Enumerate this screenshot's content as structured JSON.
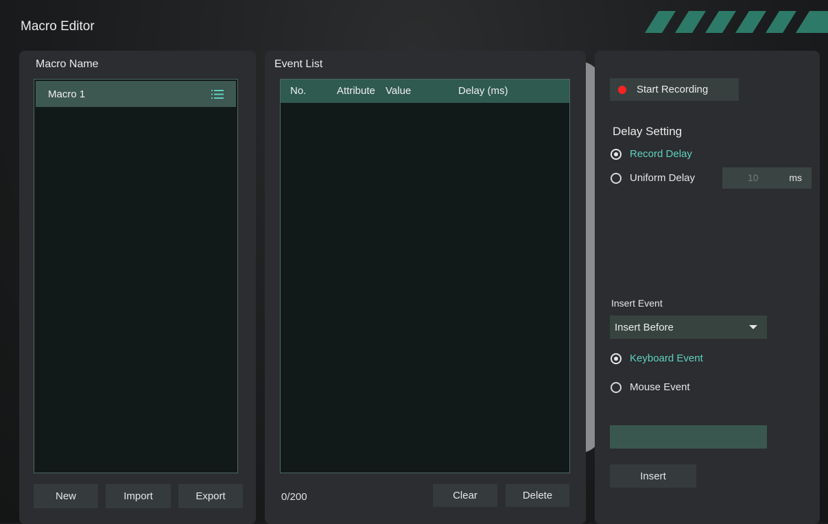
{
  "window": {
    "title": "Macro Editor"
  },
  "macro_panel": {
    "title": "Macro Name",
    "items": [
      {
        "label": "Macro 1",
        "icon": "list-icon"
      }
    ],
    "buttons": {
      "new": "New",
      "import": "Import",
      "export": "Export"
    }
  },
  "event_panel": {
    "title": "Event List",
    "columns": [
      "No.",
      "Attribute",
      "Value",
      "Delay (ms)"
    ],
    "rows": [],
    "count": "0/200",
    "buttons": {
      "clear": "Clear",
      "delete": "Delete"
    }
  },
  "settings_panel": {
    "record_button": "Start Recording",
    "delay_setting": {
      "title": "Delay Setting",
      "record_delay": "Record Delay",
      "uniform_delay": "Uniform Delay",
      "selected": "Record Delay",
      "uniform_value": "10",
      "unit": "ms"
    },
    "insert_event": {
      "title": "Insert Event",
      "position": "Insert Before",
      "keyboard_event": "Keyboard Event",
      "mouse_event": "Mouse Event",
      "selected": "Keyboard Event",
      "key_value": "",
      "insert_button": "Insert"
    }
  },
  "colors": {
    "accent": "#5fd2c0",
    "header_green": "#2f5a50",
    "selected_row": "#3d5751",
    "record_red": "#ff2222",
    "panel": "#2b2d30"
  }
}
